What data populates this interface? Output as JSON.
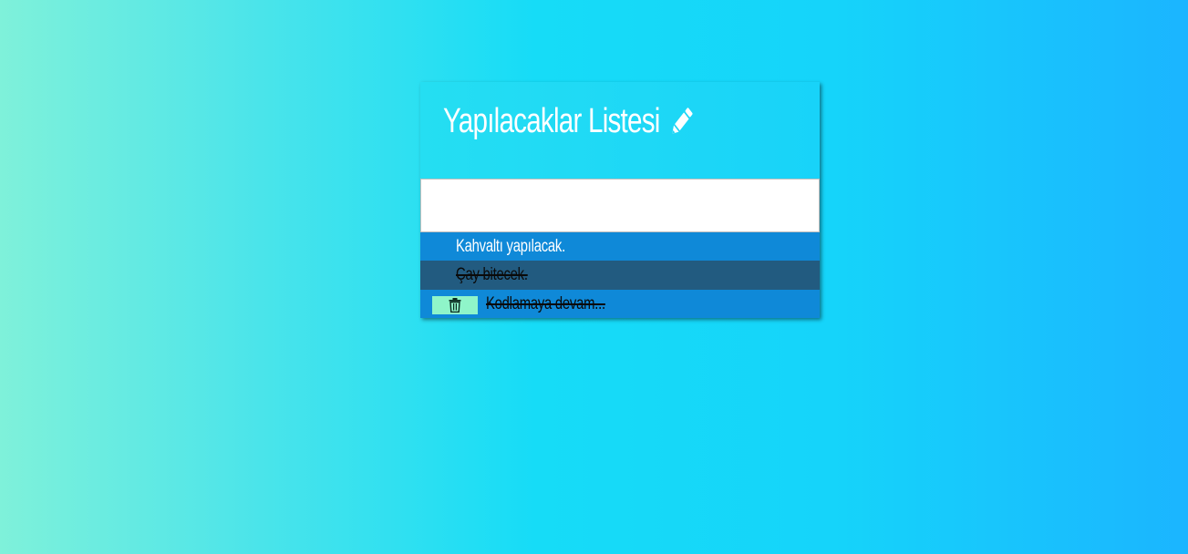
{
  "title": "Yapılacaklar Listesi",
  "input": {
    "value": "",
    "placeholder": ""
  },
  "todos": [
    {
      "text": "Kahvaltı yapılacak.",
      "completed": false,
      "delete_visible": false
    },
    {
      "text": "Çay bitecek.",
      "completed": true,
      "delete_visible": false
    },
    {
      "text": "Kodlamaya devam...",
      "completed": true,
      "delete_visible": true
    }
  ],
  "icons": {
    "title_icon": "pencil-icon",
    "delete_icon": "trash-icon"
  },
  "colors": {
    "header": "#1bd6f7",
    "item_active": "#0f89d8",
    "item_completed_dark": "#225b80",
    "delete_button": "#8ff5c9"
  }
}
